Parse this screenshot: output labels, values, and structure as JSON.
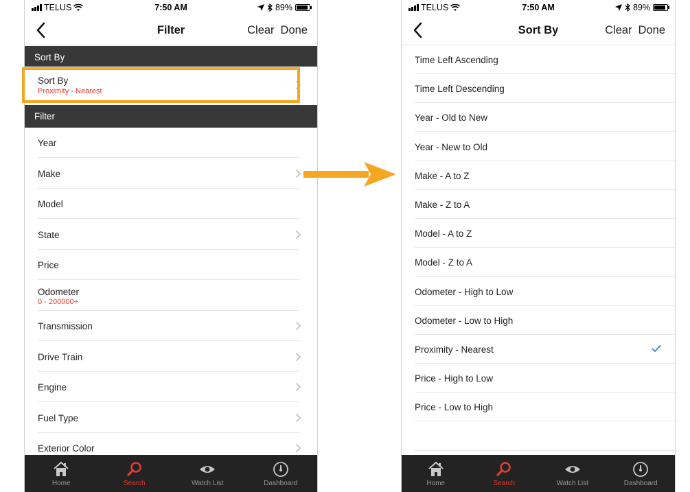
{
  "status": {
    "carrier": "TELUS",
    "time": "7:50 AM",
    "battery": "89%",
    "battery_level": 0.89
  },
  "left": {
    "nav": {
      "title": "Filter",
      "clear_label": "Clear",
      "done_label": "Done"
    },
    "sort_section": "Sort By",
    "sort_row": {
      "label": "Sort By",
      "value": "Proximity - Nearest"
    },
    "filter_section": "Filter",
    "filters": [
      {
        "label": "Year",
        "value": "",
        "chevron": false
      },
      {
        "label": "Make",
        "value": "",
        "chevron": true
      },
      {
        "label": "Model",
        "value": "",
        "chevron": false
      },
      {
        "label": "State",
        "value": "",
        "chevron": true
      },
      {
        "label": "Price",
        "value": "",
        "chevron": false
      },
      {
        "label": "Odometer",
        "value": "0 - 200000+",
        "chevron": false
      },
      {
        "label": "Transmission",
        "value": "",
        "chevron": true
      },
      {
        "label": "Drive Train",
        "value": "",
        "chevron": true
      },
      {
        "label": "Engine",
        "value": "",
        "chevron": true
      },
      {
        "label": "Fuel Type",
        "value": "",
        "chevron": true
      },
      {
        "label": "Exterior Color",
        "value": "",
        "chevron": true
      }
    ]
  },
  "right": {
    "nav": {
      "title": "Sort By",
      "clear_label": "Clear",
      "done_label": "Done"
    },
    "options": [
      "Time Left Ascending",
      "Time Left Descending",
      "Year - Old to New",
      "Year - New to Old",
      "Make - A to Z",
      "Make - Z to A",
      "Model - A to Z",
      "Model - Z to A",
      "Odometer - High to Low",
      "Odometer - Low to High",
      "Proximity - Nearest",
      "Price - High to Low",
      "Price - Low to High"
    ],
    "selected": "Proximity - Nearest"
  },
  "tabs": [
    {
      "label": "Home",
      "icon": "home-icon",
      "active": false
    },
    {
      "label": "Search",
      "icon": "search-icon",
      "active": true
    },
    {
      "label": "Watch List",
      "icon": "eye-icon",
      "active": false
    },
    {
      "label": "Dashboard",
      "icon": "speedometer-icon",
      "active": false
    }
  ],
  "colors": {
    "accent_red": "#e63a2e",
    "highlight_orange": "#f5a623",
    "header_dark": "#383838",
    "tab_bar": "#232323",
    "check_blue": "#2f7de1"
  }
}
